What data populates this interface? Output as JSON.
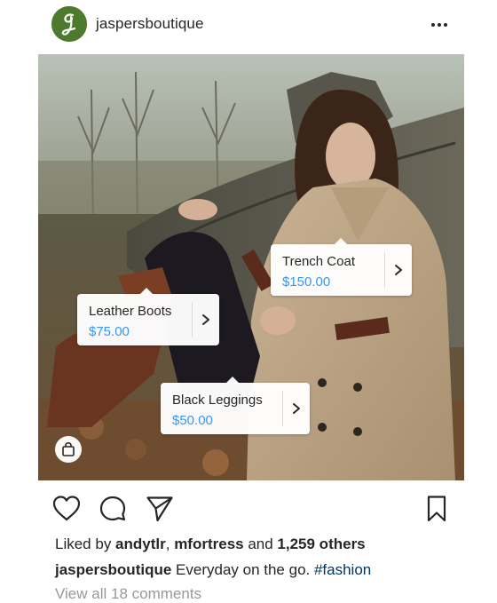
{
  "post": {
    "username": "jaspersboutique",
    "avatar_icon": "script-j-logo-icon",
    "avatar_color": "#4e7a2d",
    "more_icon": "more-horizontal-icon"
  },
  "product_tags": [
    {
      "name": "Trench Coat",
      "price": "$150.00"
    },
    {
      "name": "Leather Boots",
      "price": "$75.00"
    },
    {
      "name": "Black Leggings",
      "price": "$50.00"
    }
  ],
  "shopping_icon": "shopping-bag-icon",
  "actions": {
    "like_icon": "heart-icon",
    "comment_icon": "comment-icon",
    "share_icon": "send-icon",
    "save_icon": "bookmark-icon"
  },
  "likes": {
    "prefix": "Liked by ",
    "user1": "andytlr",
    "sep": ", ",
    "user2": "mfortress",
    "and": " and ",
    "others": "1,259 others"
  },
  "caption": {
    "username": "jaspersboutique",
    "text": " Everyday on the go. ",
    "hashtag": "#fashion"
  },
  "comments_link": "View all 18 comments",
  "colors": {
    "price_blue": "#3897f0",
    "hashtag_blue": "#003569",
    "muted_gray": "#999999"
  }
}
